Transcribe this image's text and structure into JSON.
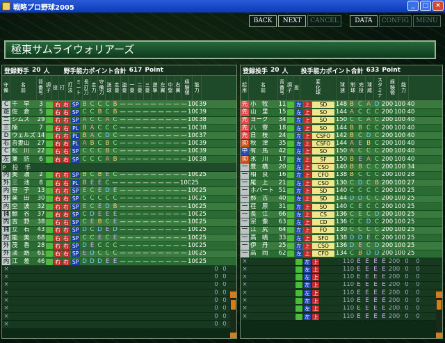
{
  "window": {
    "title": "戦略プロ野球2005"
  },
  "toolbar": {
    "back": "BACK",
    "next": "NEXT",
    "cancel": "CANCEL",
    "data": "DATA",
    "config": "CONFIG",
    "menu": "MENU"
  },
  "team_name": "極東サムライウォリアーズ",
  "fielders": {
    "count_label": "登録野手",
    "count": "20",
    "unit": "人",
    "points_label": "野手能力ポイント合計",
    "points": "617",
    "points_unit": "Point",
    "headers": [
      "守備",
      "名前",
      "背番号",
      "調子",
      "投",
      "打",
      "打法",
      "ミート",
      "長打力",
      "走力",
      "守備力",
      "送球",
      "走塁",
      "盗塁",
      "一塁",
      "二塁",
      "三塁",
      "遊撃",
      "左翼",
      "中堅",
      "右翼",
      "経験値",
      "能力"
    ],
    "rows": [
      {
        "pos": "C",
        "name": "千　早",
        "num": "3",
        "sty": "SP",
        "g": "B C C C B",
        "n1": "100",
        "n2": "39"
      },
      {
        "pos": "遊",
        "name": "佐　倉",
        "num": "5",
        "sty": "SP",
        "g": "C C B C B",
        "n1": "100",
        "n2": "39"
      },
      {
        "pos": "二",
        "name": "シムス",
        "num": "29",
        "sty": "SP",
        "g": "A C C A C",
        "n1": "100",
        "n2": "38"
      },
      {
        "pos": "三",
        "name": "楠",
        "num": "7",
        "sty": "PL",
        "g": "B A C C C",
        "n1": "100",
        "n2": "38"
      },
      {
        "pos": "D",
        "name": "ウェルズ",
        "num": "14",
        "sty": "PL",
        "g": "B A C D C",
        "n1": "100",
        "n2": "37"
      },
      {
        "pos": "右",
        "name": "吾妻山",
        "num": "27",
        "sty": "PL",
        "g": "A B C B C",
        "n1": "100",
        "n2": "39"
      },
      {
        "pos": "C",
        "name": "松　川",
        "num": "22",
        "sty": "SP",
        "g": "C C C B C",
        "n1": "100",
        "n2": "39"
      },
      {
        "pos": "左",
        "name": "兼　訪",
        "num": "6",
        "sty": "SP",
        "g": "C C C A B",
        "n1": "100",
        "n2": "38"
      }
    ],
    "pitcher_sep": "P　投　手",
    "rows2": [
      {
        "pos": "内",
        "name": "美　濃",
        "num": "2",
        "sty": "SP",
        "g": "B C B E C",
        "n1": "100",
        "n2": "25"
      },
      {
        "pos": "外",
        "name": "三　池",
        "num": "8",
        "sty": "PL",
        "g": "B E E C",
        "n1": "100",
        "n2": "25"
      },
      {
        "pos": "内",
        "name": "笹　子",
        "num": "13",
        "sty": "SP",
        "g": "E C E D E",
        "n1": "100",
        "n2": "25"
      },
      {
        "pos": "外",
        "name": "薬　田",
        "num": "30",
        "sty": "SP",
        "g": "C C C C C",
        "n1": "100",
        "n2": "25"
      },
      {
        "pos": "内",
        "name": "空　波",
        "num": "32",
        "sty": "SP",
        "g": "E C E D B",
        "n1": "100",
        "n2": "25"
      },
      {
        "pos": "捕",
        "name": "鯨　谷",
        "num": "37",
        "sty": "SP",
        "g": "C D E E E",
        "n1": "100",
        "n2": "25"
      },
      {
        "pos": "内",
        "name": "吉　野",
        "num": "38",
        "sty": "SP",
        "g": "C E B C E",
        "n1": "100",
        "n2": "25"
      },
      {
        "pos": "捕",
        "name": "立　石",
        "num": "43",
        "sty": "SP",
        "g": "D C D E D",
        "n1": "100",
        "n2": "25"
      },
      {
        "pos": "内",
        "name": "能　美",
        "num": "68",
        "sty": "SP",
        "g": "C C E C E",
        "n1": "100",
        "n2": "25"
      },
      {
        "pos": "外",
        "name": "茂　香",
        "num": "28",
        "sty": "SP",
        "g": "D E C C C",
        "n1": "100",
        "n2": "25"
      },
      {
        "pos": "外",
        "name": "淡　路",
        "num": "61",
        "sty": "SP",
        "g": "E D C C C",
        "n1": "100",
        "n2": "25"
      },
      {
        "pos": "内",
        "name": "江　差",
        "num": "46",
        "sty": "SP",
        "g": "D D D E E",
        "n1": "100",
        "n2": "25"
      }
    ],
    "empty_rows": 8,
    "empty_mark": "×",
    "empty_n1": "0",
    "empty_n2": "0"
  },
  "pitchers": {
    "count_label": "登録投手",
    "count": "20",
    "unit": "人",
    "points_label": "投手能力ポイント合計",
    "points": "633",
    "points_unit": "Point",
    "headers": [
      "起用",
      "名前",
      "背番号",
      "調子",
      "投",
      "変化球",
      "球速",
      "制球",
      "完投",
      "球威",
      "スタミナ",
      "経験値",
      "能力"
    ],
    "rows": [
      {
        "role": "先",
        "name": "小　牧",
        "num": "11",
        "tag": "SD",
        "spd": "148",
        "g": "B C A D",
        "st": "200",
        "n1": "100",
        "n2": "40"
      },
      {
        "role": "先",
        "name": "山　里",
        "num": "15",
        "tag": "SO",
        "spd": "144",
        "g": "A C C C",
        "st": "200",
        "n1": "100",
        "n2": "40"
      },
      {
        "role": "先",
        "name": "ヨーク",
        "num": "34",
        "tag": "SO",
        "spd": "150",
        "g": "C C A C",
        "st": "200",
        "n1": "100",
        "n2": "40"
      },
      {
        "role": "先",
        "name": "八　寮",
        "num": "18",
        "tag": "SO",
        "spd": "144",
        "g": "B B C C",
        "st": "200",
        "n1": "100",
        "n2": "40"
      },
      {
        "role": "先",
        "name": "日　枝",
        "num": "24",
        "tag": "CSFO",
        "spd": "142",
        "g": "B C D C",
        "st": "200",
        "n1": "100",
        "n2": "40"
      },
      {
        "role": "抑",
        "name": "秋　津",
        "num": "35",
        "tag": "CSFO",
        "spd": "144",
        "g": "A E B C",
        "st": "200",
        "n1": "100",
        "n2": "40"
      },
      {
        "role": "中",
        "name": "有　馬",
        "num": "42",
        "tag": "SO",
        "spd": "150",
        "g": "A C C C",
        "st": "200",
        "n1": "100",
        "n2": "40"
      },
      {
        "role": "抑",
        "name": "氷　川",
        "num": "17",
        "tag": "SF",
        "spd": "150",
        "g": "B E A C",
        "st": "200",
        "n1": "100",
        "n2": "40"
      },
      {
        "role": "一",
        "name": "豊　橋",
        "num": "20",
        "tag": "CSO",
        "spd": "140",
        "g": "B B C C",
        "st": "200",
        "n1": "100",
        "n2": "34"
      },
      {
        "role": "一",
        "name": "相　良",
        "num": "16",
        "tag": "CFO",
        "spd": "138",
        "g": "B C C C",
        "st": "200",
        "n1": "100",
        "n2": "28"
      },
      {
        "role": "一",
        "name": "尾　上",
        "num": "21",
        "tag": "CSO",
        "spd": "130",
        "g": "C D C B",
        "st": "200",
        "n1": "100",
        "n2": "27"
      },
      {
        "role": "一",
        "name": "ホバート",
        "num": "51",
        "tag": "SD",
        "spd": "140",
        "g": "C C C C",
        "st": "200",
        "n1": "100",
        "n2": "25"
      },
      {
        "role": "一",
        "name": "那　古",
        "num": "40",
        "tag": "SD",
        "spd": "144",
        "g": "D D C C",
        "st": "200",
        "n1": "100",
        "n2": "25"
      },
      {
        "role": "一",
        "name": "荏　原",
        "num": "31",
        "tag": "SO",
        "spd": "140",
        "g": "C E C C",
        "st": "200",
        "n1": "100",
        "n2": "25"
      },
      {
        "role": "一",
        "name": "長　江",
        "num": "66",
        "tag": "CS",
        "spd": "136",
        "g": "C E C D",
        "st": "200",
        "n1": "100",
        "n2": "25"
      },
      {
        "role": "一",
        "name": "宗　像",
        "num": "63",
        "tag": "CD",
        "spd": "136",
        "g": "C C D C",
        "st": "200",
        "n1": "100",
        "n2": "25"
      },
      {
        "role": "一",
        "name": "江　尻",
        "num": "64",
        "tag": "FO",
        "spd": "130",
        "g": "C C C C",
        "st": "200",
        "n1": "100",
        "n2": "25"
      },
      {
        "role": "一",
        "name": "高　嶋",
        "num": "33",
        "tag": "SFO",
        "spd": "138",
        "g": "D D E C",
        "st": "200",
        "n1": "100",
        "n2": "25"
      },
      {
        "role": "一",
        "name": "伊　丹",
        "num": "25",
        "tag": "CSO",
        "spd": "136",
        "g": "D E C D",
        "st": "200",
        "n1": "100",
        "n2": "25"
      },
      {
        "role": "一",
        "name": "高　岡",
        "num": "62",
        "tag": "CFO",
        "spd": "134",
        "g": "C B D D",
        "st": "200",
        "n1": "100",
        "n2": "25"
      }
    ],
    "empty_rows": 8,
    "empty_mark": "×",
    "empty_spd": "110",
    "empty_g": "E E E E",
    "empty_st": "200",
    "empty_n1": "0",
    "empty_n2": "0"
  },
  "hands": {
    "right": "右",
    "left": "左",
    "up": "上"
  }
}
